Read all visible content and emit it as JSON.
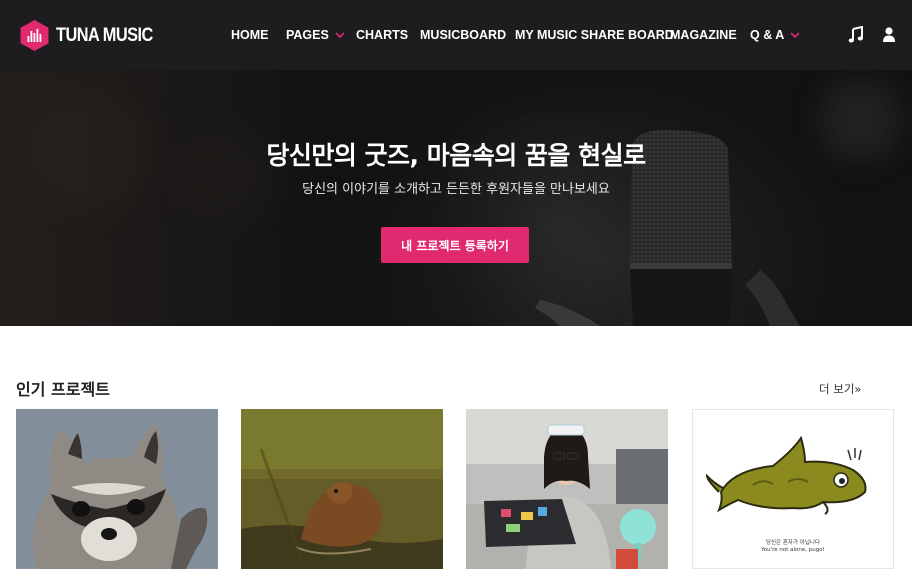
{
  "brand": {
    "name": "TUNA MUSIC",
    "logo_icon": "equalizer-hexagon-icon",
    "accent": "#e0296f"
  },
  "nav": {
    "items": [
      {
        "label": "HOME",
        "has_dropdown": false
      },
      {
        "label": "PAGES",
        "has_dropdown": true
      },
      {
        "label": "CHARTS",
        "has_dropdown": false
      },
      {
        "label": "MUSICBOARD",
        "has_dropdown": false
      },
      {
        "label": "MY MUSIC SHARE BOARD",
        "has_dropdown": false
      },
      {
        "label": "MAGAZINE",
        "has_dropdown": false
      },
      {
        "label": "Q & A",
        "has_dropdown": true
      }
    ],
    "icons": [
      "music-note-icon",
      "user-icon"
    ]
  },
  "hero": {
    "title": "당신만의 굿즈, 마음속의 꿈을 현실로",
    "subtitle": "당신의 이야기를 소개하고 든든한 후원자들을 만나보세요",
    "cta_label": "내 프로젝트 등록하기"
  },
  "popular": {
    "title": "인기 프로젝트",
    "more_label": "더 보기»",
    "cards": [
      {
        "image": "raccoon-photo"
      },
      {
        "image": "beaver-photo"
      },
      {
        "image": "student-at-laptop-photo"
      },
      {
        "image": "fish-illustration",
        "caption_line1": "당신은 혼자가 아닙니다",
        "caption_line2": "You're not alone, pugo!"
      }
    ]
  }
}
